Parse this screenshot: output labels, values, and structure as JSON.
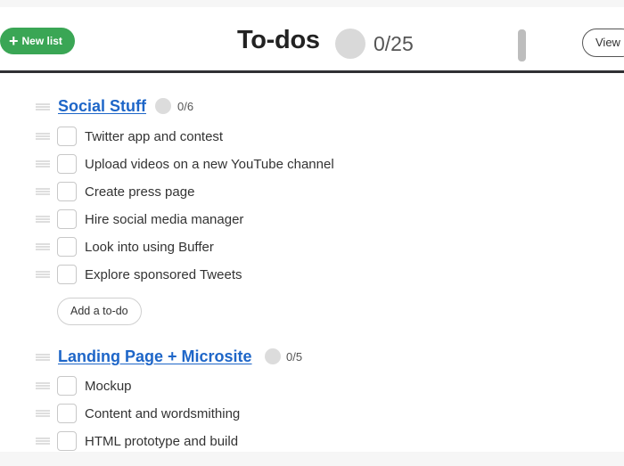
{
  "header": {
    "new_list_label": "New list",
    "title": "To-dos",
    "count": "0/25",
    "view_label": "View"
  },
  "lists": [
    {
      "title": "Social Stuff",
      "count": "0/6",
      "items": [
        "Twitter app and contest",
        "Upload videos on a new YouTube channel",
        "Create press page",
        "Hire social media manager",
        "Look into using Buffer",
        "Explore sponsored Tweets"
      ],
      "add_label": "Add a to-do"
    },
    {
      "title": "Landing Page + Microsite",
      "count": "0/5",
      "items": [
        "Mockup",
        "Content and wordsmithing",
        "HTML prototype and build"
      ]
    }
  ],
  "colors": {
    "accent_green": "#3aa655",
    "link_blue": "#1e66c8"
  }
}
